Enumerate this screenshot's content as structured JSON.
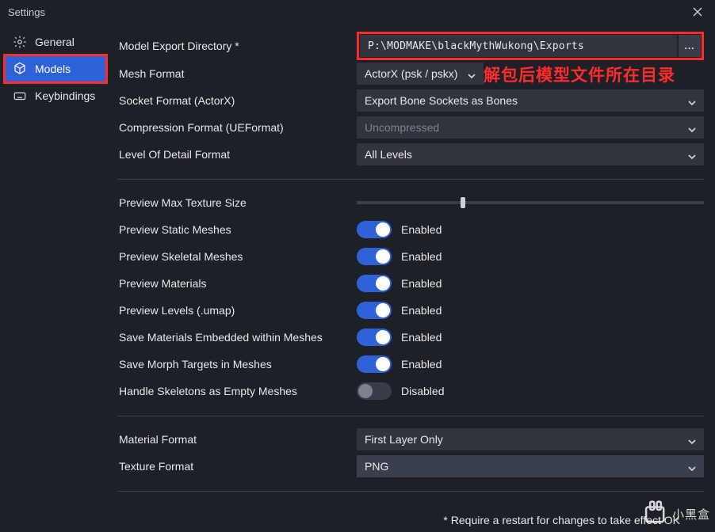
{
  "window": {
    "title": "Settings"
  },
  "sidebar": {
    "items": [
      {
        "label": "General"
      },
      {
        "label": "Models"
      },
      {
        "label": "Keybindings"
      }
    ]
  },
  "labels": {
    "export_dir": "Model Export Directory *",
    "mesh_format": "Mesh Format",
    "socket_format": "Socket Format (ActorX)",
    "compression": "Compression Format (UEFormat)",
    "lod_format": "Level Of Detail Format",
    "preview_max_tex": "Preview Max Texture Size",
    "preview_static": "Preview Static Meshes",
    "preview_skeletal": "Preview Skeletal Meshes",
    "preview_materials": "Preview Materials",
    "preview_levels": "Preview Levels (.umap)",
    "save_mat": "Save Materials Embedded within Meshes",
    "save_morph": "Save Morph Targets in Meshes",
    "handle_skel": "Handle Skeletons as Empty Meshes",
    "material_format": "Material Format",
    "texture_format": "Texture Format"
  },
  "values": {
    "export_dir": "P:\\MODMAKE\\blackMythWukong\\Exports",
    "mesh_format": "ActorX (psk / pskx)",
    "socket_format": "Export Bone Sockets as Bones",
    "compression": "Uncompressed",
    "lod_format": "All Levels",
    "material_format": "First Layer Only",
    "texture_format": "PNG",
    "browse_btn": "..."
  },
  "toggles": {
    "enabled": "Enabled",
    "disabled": "Disabled"
  },
  "overlay": "解包后模型文件所在目录",
  "footer": "* Require a restart for changes to take effect  OK",
  "watermark": "小黑盒"
}
